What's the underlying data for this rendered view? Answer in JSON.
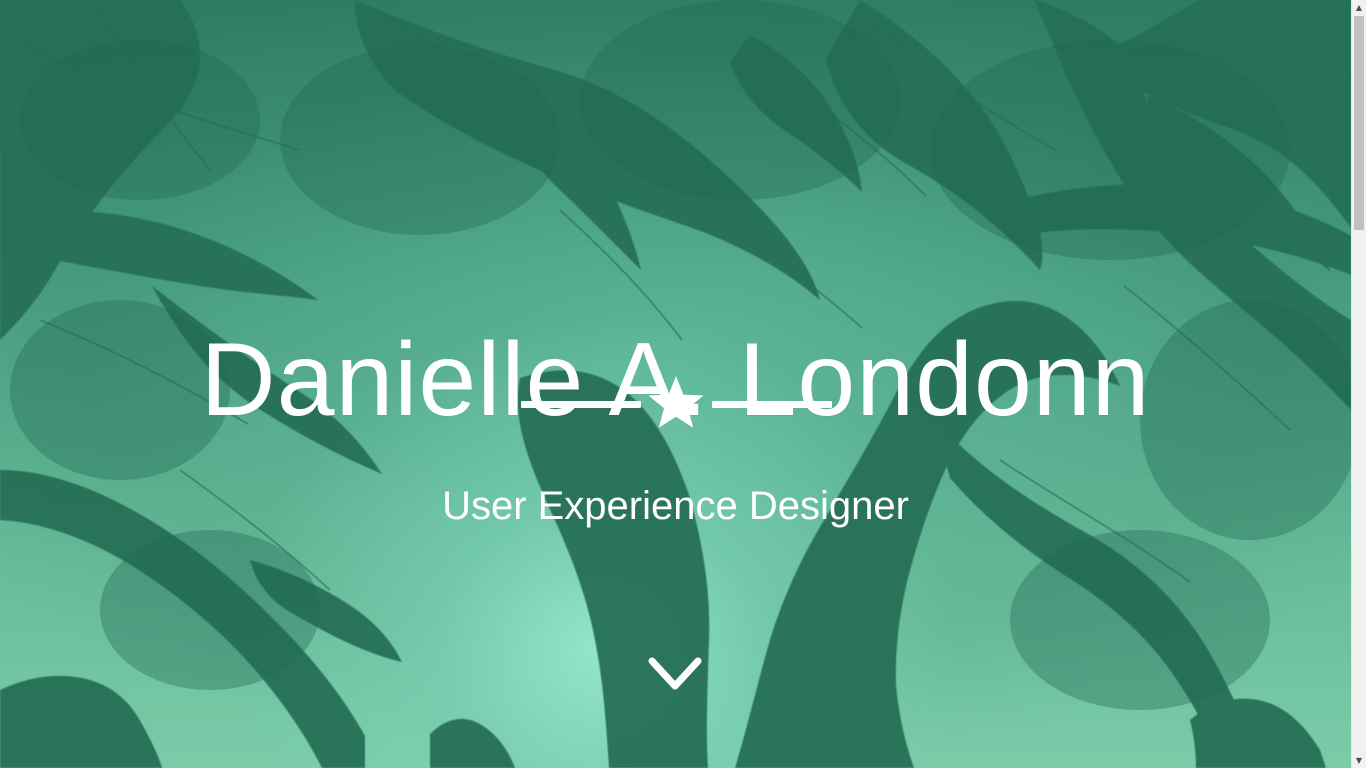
{
  "hero": {
    "title": "Danielle A. Londonn",
    "subtitle": "User Experience Designer",
    "divider_icon": "star-icon",
    "scroll_icon": "chevron-down-icon"
  },
  "theme": {
    "accent": "#2b7058",
    "overlay_light": "#7bcca9",
    "text": "#ffffff"
  }
}
